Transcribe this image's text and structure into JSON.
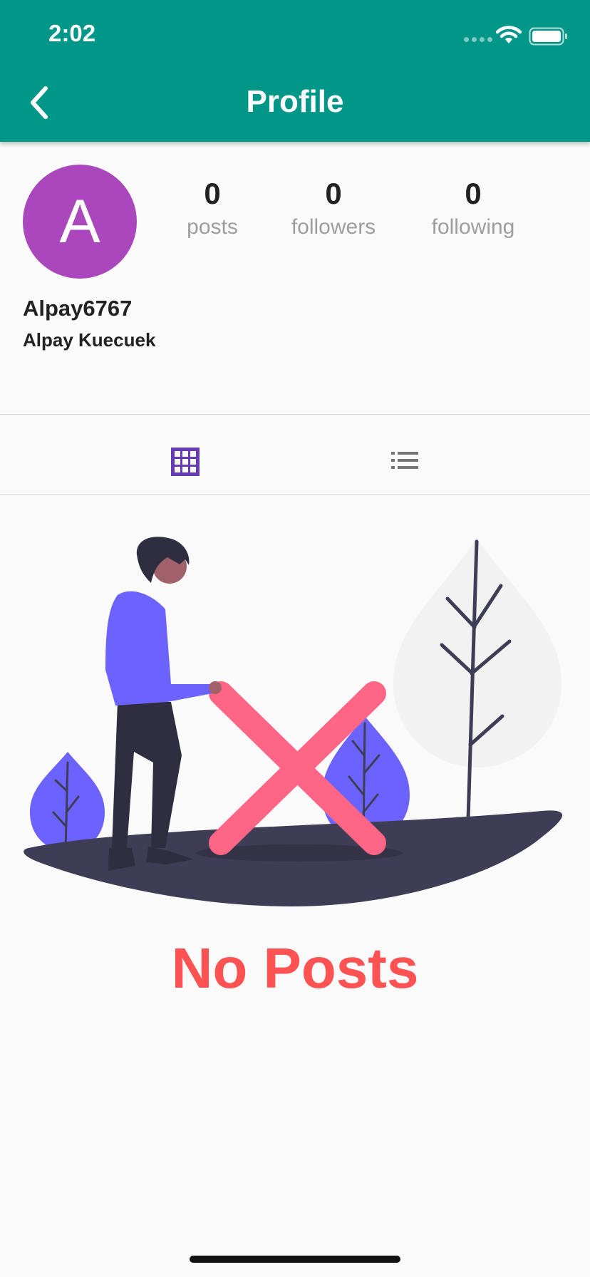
{
  "status_bar": {
    "time": "2:02"
  },
  "nav": {
    "title": "Profile",
    "back_icon": "chevron-left-icon"
  },
  "profile": {
    "avatar_letter": "A",
    "avatar_color": "#ab47bc",
    "username": "Alpay6767",
    "full_name": "Alpay Kuecuek",
    "stats": [
      {
        "value": "0",
        "label": "posts"
      },
      {
        "value": "0",
        "label": "followers"
      },
      {
        "value": "0",
        "label": "following"
      }
    ]
  },
  "view_toggle": {
    "grid_icon": "grid-icon",
    "list_icon": "list-icon",
    "active": "grid",
    "active_color": "#673ab7"
  },
  "empty_state": {
    "message": "No Posts",
    "color": "#ff5252"
  },
  "colors": {
    "header": "#009688",
    "background": "#fafafa"
  }
}
